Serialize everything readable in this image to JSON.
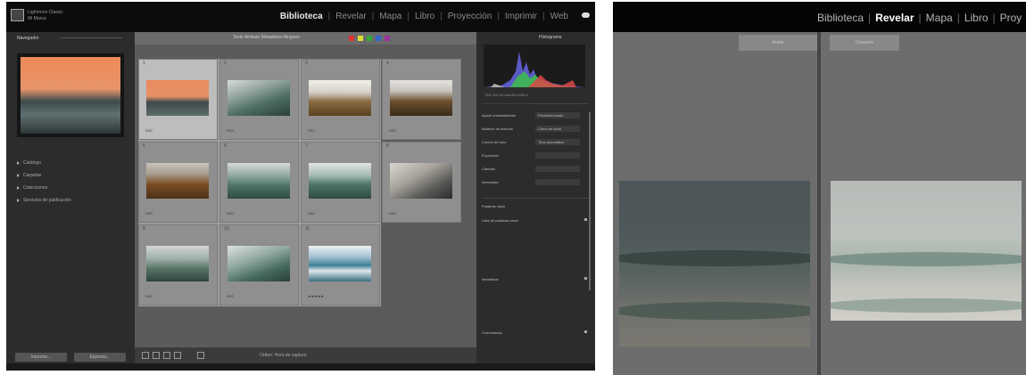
{
  "left_window": {
    "id_lines": [
      "Lightroom Classic",
      "Mi Marca"
    ],
    "modules": [
      "Biblioteca",
      "Revelar",
      "Mapa",
      "Libro",
      "Proyección",
      "Imprimir",
      "Web"
    ],
    "active_module": "Biblioteca",
    "navigator_label": "Navegador",
    "catalog_items": [
      "Catálogo",
      "Carpetas",
      "Colecciones",
      "Servicios de publicación"
    ],
    "import_label": "Importar...",
    "export_label": "Exportar...",
    "filter_label": "Texto  Atributo  Metadatos  Ninguno",
    "grid": [
      {
        "num": "1",
        "meta": "DSC",
        "thumb": "t1",
        "selected": true
      },
      {
        "num": "2",
        "meta": "DSC",
        "thumb": "t2",
        "selected": false
      },
      {
        "num": "3",
        "meta": "DSC",
        "thumb": "t3",
        "selected": false
      },
      {
        "num": "4",
        "meta": "DSC",
        "thumb": "t4",
        "selected": false
      },
      {
        "num": "5",
        "meta": "DSC",
        "thumb": "t5",
        "selected": false
      },
      {
        "num": "6",
        "meta": "DSC",
        "thumb": "t6",
        "selected": false
      },
      {
        "num": "7",
        "meta": "DSC",
        "thumb": "t7",
        "selected": false
      },
      {
        "num": "8",
        "meta": "DSC",
        "thumb": "t8",
        "selected": false
      },
      {
        "num": "9",
        "meta": "DSC",
        "thumb": "t9",
        "selected": false
      },
      {
        "num": "10",
        "meta": "DSC",
        "thumb": "t10",
        "selected": false
      },
      {
        "num": "11",
        "meta": "★★★★★",
        "thumb": "t11",
        "selected": false
      }
    ],
    "sort_label": "Orden: Hora de captura",
    "histogram_label": "Histograma",
    "histogram_info": "ISO 100   24 mm   f/8   1/250 s",
    "right_rows": [
      {
        "label": "Ajuste preestablecido",
        "value": "Predeterminado"
      },
      {
        "label": "Balance de blancos",
        "value": "Como se tomó"
      },
      {
        "label": "Control de tono",
        "value": "Tono automático"
      },
      {
        "label": "Exposición",
        "value": ""
      },
      {
        "label": "Claridad",
        "value": ""
      },
      {
        "label": "Intensidad",
        "value": ""
      }
    ],
    "keywording_label": "Palabras clave",
    "keyword_list_label": "Lista de palabras clave",
    "metadata_label": "Metadatos",
    "comments_label": "Comentarios"
  },
  "right_window": {
    "modules": [
      "Biblioteca",
      "Revelar",
      "Mapa",
      "Libro",
      "Proy"
    ],
    "active_module": "Revelar",
    "before_label": "Antes",
    "after_label": "Después"
  }
}
